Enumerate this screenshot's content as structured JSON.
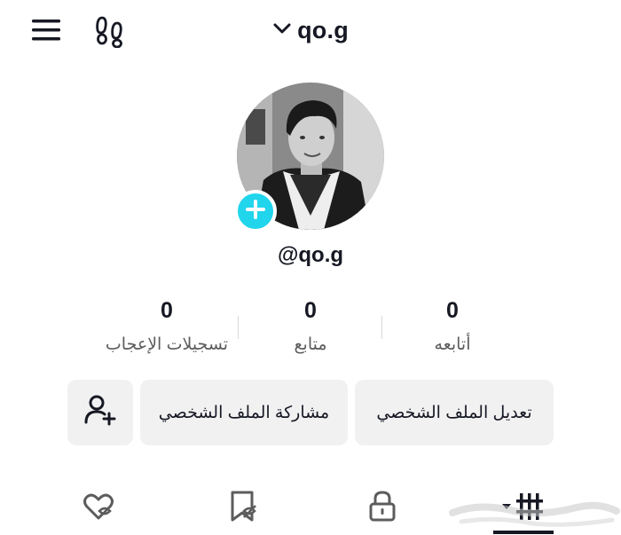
{
  "header": {
    "username_title": "qo.g",
    "menu_icon": "hamburger-menu-icon",
    "steps_icon": "footsteps-icon",
    "dropdown_icon": "chevron-down-icon"
  },
  "profile": {
    "handle": "@qo.g",
    "avatar_icon": "profile-photo",
    "add_icon": "plus-icon",
    "accent_color": "#20d5ec"
  },
  "stats": [
    {
      "value": "0",
      "label": "أتابعه"
    },
    {
      "value": "0",
      "label": "متابع"
    },
    {
      "value": "0",
      "label": "تسجيلات الإعجاب"
    }
  ],
  "actions": {
    "edit_profile": "تعديل الملف الشخصي",
    "share_profile": "مشاركة الملف الشخصي",
    "add_friend_icon": "add-user-icon"
  },
  "tabs": [
    {
      "icon": "grid-videos-icon",
      "selected": true
    },
    {
      "icon": "lock-icon",
      "selected": false
    },
    {
      "icon": "bookmark-hidden-icon",
      "selected": false
    },
    {
      "icon": "heart-hidden-icon",
      "selected": false
    }
  ]
}
